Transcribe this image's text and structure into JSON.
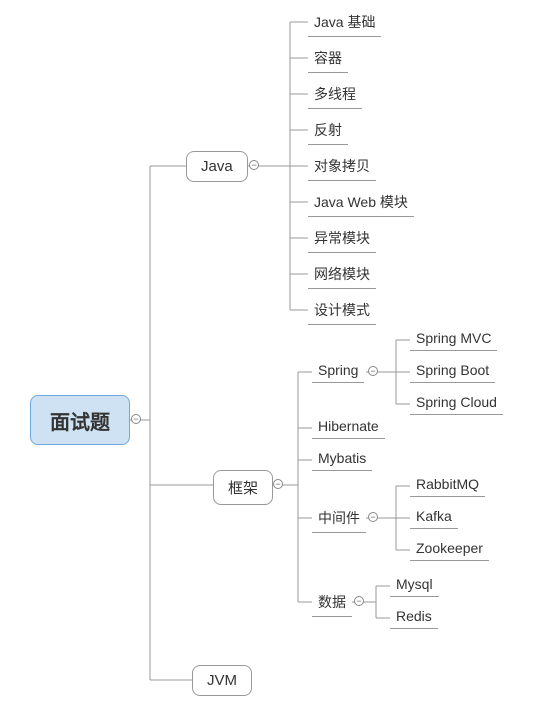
{
  "root": {
    "label": "面试题"
  },
  "java": {
    "label": "Java",
    "children": [
      "Java 基础",
      "容器",
      "多线程",
      "反射",
      "对象拷贝",
      "Java Web 模块",
      "异常模块",
      "网络模块",
      "设计模式"
    ]
  },
  "framework": {
    "label": "框架",
    "spring": {
      "label": "Spring",
      "children": [
        "Spring MVC",
        "Spring Boot",
        "Spring Cloud"
      ]
    },
    "hibernate": {
      "label": "Hibernate"
    },
    "mybatis": {
      "label": "Mybatis"
    },
    "middleware": {
      "label": "中间件",
      "children": [
        "RabbitMQ",
        "Kafka",
        "Zookeeper"
      ]
    },
    "data": {
      "label": "数据",
      "children": [
        "Mysql",
        "Redis"
      ]
    }
  },
  "jvm": {
    "label": "JVM"
  },
  "toggle_glyph": "−"
}
